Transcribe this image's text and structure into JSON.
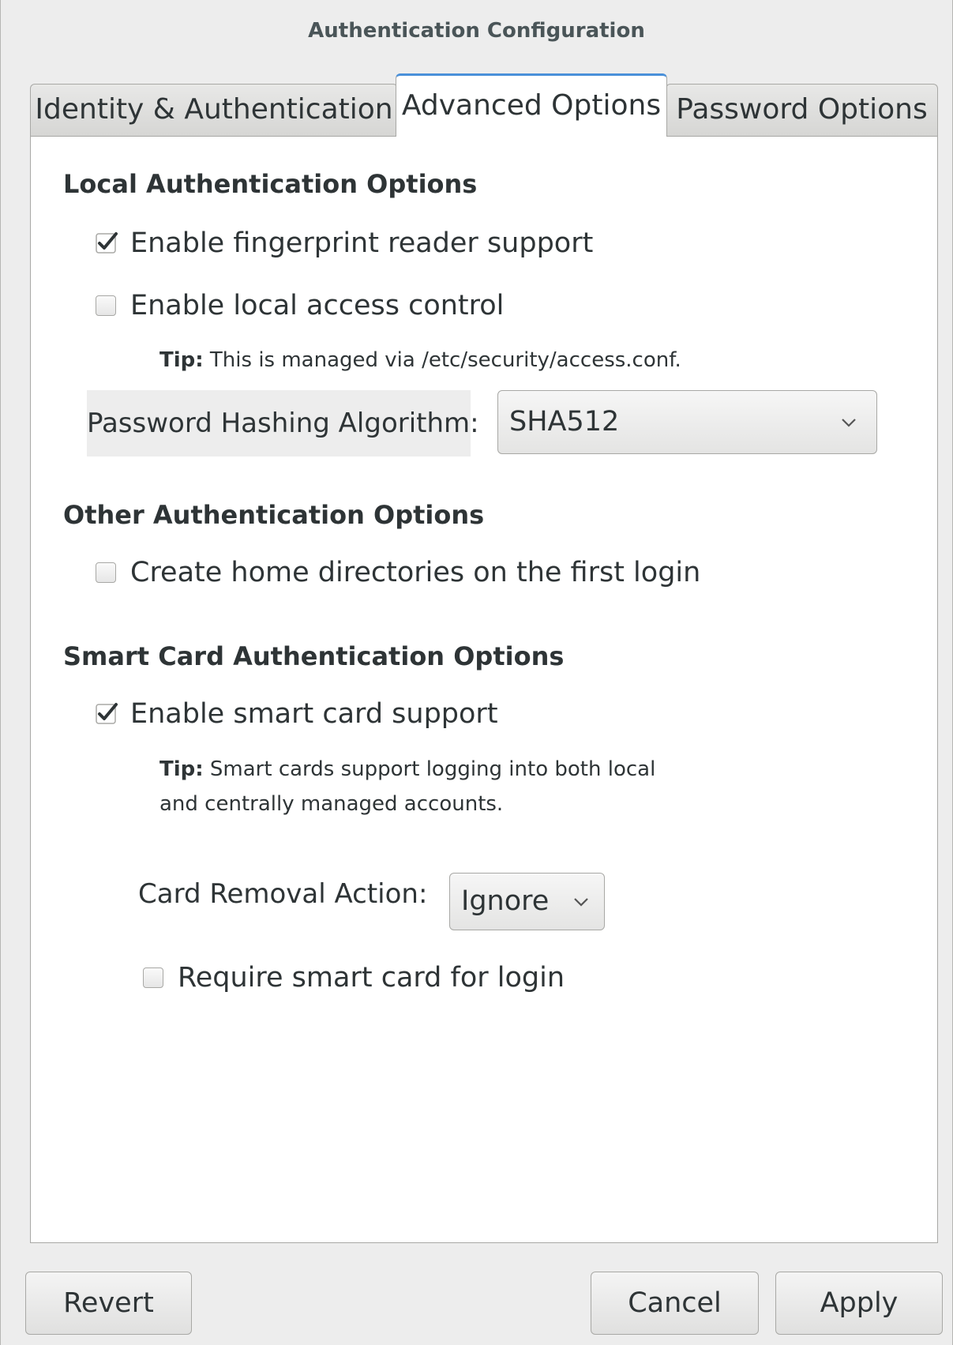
{
  "window": {
    "title": "Authentication Configuration"
  },
  "tabs": [
    {
      "label": "Identity & Authentication"
    },
    {
      "label": "Advanced Options"
    },
    {
      "label": "Password Options"
    }
  ],
  "local": {
    "title": "Local Authentication Options",
    "fingerprint": {
      "label": "Enable fingerprint reader support",
      "checked": true
    },
    "access_control": {
      "label": "Enable local access control",
      "checked": false
    },
    "tip_bold": "Tip:",
    "tip_text": " This is managed via /etc/security/access.conf.",
    "hash_label": "Password Hashing Algorithm:",
    "hash_value": "SHA512"
  },
  "other": {
    "title": "Other Authentication Options",
    "home_dirs": {
      "label": "Create home directories on the first login",
      "checked": false
    }
  },
  "smartcard": {
    "title": "Smart Card Authentication Options",
    "enable": {
      "label": "Enable smart card support",
      "checked": true
    },
    "tip_bold": "Tip:",
    "tip_line1": " Smart cards support logging into both local",
    "tip_line2": "and centrally managed accounts.",
    "removal_label": "Card Removal Action:",
    "removal_value": "Ignore",
    "require": {
      "label": "Require smart card for login",
      "checked": false
    }
  },
  "buttons": {
    "revert": "Revert",
    "cancel": "Cancel",
    "apply": "Apply"
  },
  "icons": {
    "check": "checkmark-icon",
    "dropdown": "chevron-down-icon"
  }
}
